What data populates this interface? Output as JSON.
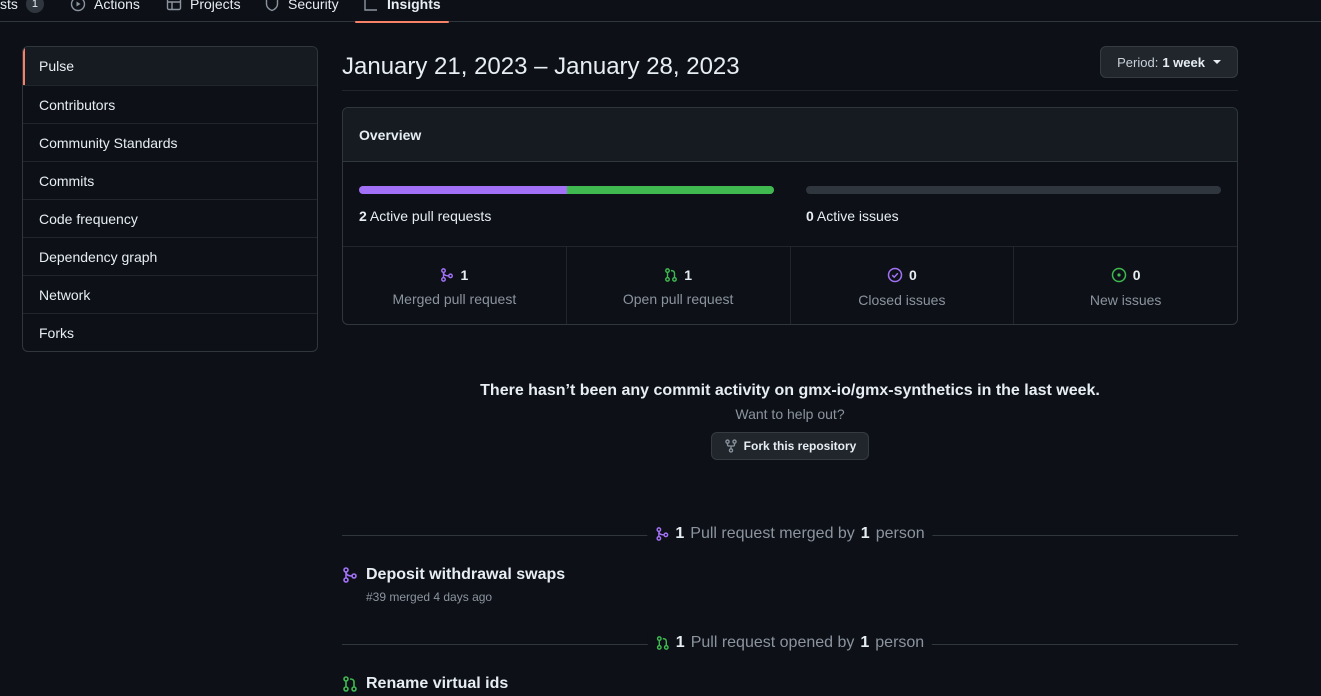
{
  "tabs": [
    {
      "label": "sts",
      "count": "1"
    },
    {
      "label": "Actions"
    },
    {
      "label": "Projects"
    },
    {
      "label": "Security"
    },
    {
      "label": "Insights"
    }
  ],
  "sidebar": {
    "items": [
      {
        "label": "Pulse"
      },
      {
        "label": "Contributors"
      },
      {
        "label": "Community Standards"
      },
      {
        "label": "Commits"
      },
      {
        "label": "Code frequency"
      },
      {
        "label": "Dependency graph"
      },
      {
        "label": "Network"
      },
      {
        "label": "Forks"
      }
    ]
  },
  "header": {
    "date_range": "January 21, 2023 – January 28, 2023",
    "period_label": "Period:",
    "period_value": "1 week"
  },
  "overview": {
    "title": "Overview",
    "pull_requests": {
      "count": "2",
      "label": "Active pull requests",
      "merged_fraction": 0.5,
      "open_fraction": 0.5
    },
    "issues": {
      "count": "0",
      "label": "Active issues"
    },
    "stats": [
      {
        "num": "1",
        "label": "Merged pull request",
        "icon": "merge-icon",
        "color": "#a371f7"
      },
      {
        "num": "1",
        "label": "Open pull request",
        "icon": "pull-request-icon",
        "color": "#3fb950"
      },
      {
        "num": "0",
        "label": "Closed issues",
        "icon": "issue-closed-icon",
        "color": "#a371f7"
      },
      {
        "num": "0",
        "label": "New issues",
        "icon": "issue-open-icon",
        "color": "#3fb950"
      }
    ]
  },
  "empty_commits": {
    "title": "There hasn’t been any commit activity on gmx-io/gmx-synthetics in the last week.",
    "subtitle": "Want to help out?",
    "fork_label": "Fork this repository"
  },
  "merged_section": {
    "count": "1",
    "text1": "Pull request merged by",
    "people": "1",
    "text2": "person"
  },
  "merged_pr": {
    "title": "Deposit withdrawal swaps",
    "meta": "#39 merged 4 days ago"
  },
  "opened_section": {
    "count": "1",
    "text1": "Pull request opened by",
    "people": "1",
    "text2": "person"
  },
  "opened_pr": {
    "title": "Rename virtual ids"
  },
  "colors": {
    "merged": "#a371f7",
    "open": "#3fb950",
    "accent": "#f78166"
  }
}
